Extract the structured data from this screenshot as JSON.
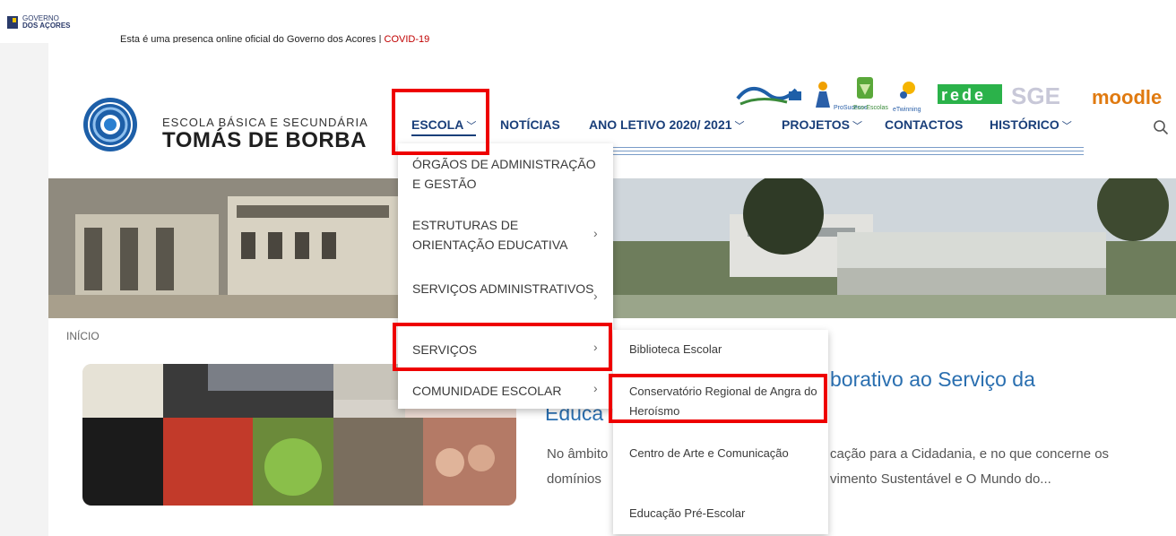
{
  "gov_bar": {
    "name_line1": "GOVERNO",
    "name_line2": "DOS AÇORES",
    "notice": "Esta é uma presenca online oficial do Governo dos Acores | ",
    "covid_link": "COVID-19"
  },
  "school": {
    "name_line1": "ESCOLA BÁSICA E SECUNDÁRIA",
    "name_line2": "TOMÁS DE BORBA"
  },
  "nav": {
    "escola": "ESCOLA",
    "noticias": "NOTÍCIAS",
    "ano_letivo": "ANO LETIVO 2020/ 2021",
    "projetos": "PROJETOS",
    "contactos": "CONTACTOS",
    "historico": "HISTÓRICO"
  },
  "partner_logos": [
    "ProSucesso",
    "Eco-Escolas",
    "eTwinning",
    "rede",
    "SGE",
    "moodle"
  ],
  "dropdown": {
    "items": [
      "ÓRGÃOS DE ADMINISTRAÇÃO E GESTÃO",
      "ESTRUTURAS DE ORIENTAÇÃO EDUCATIVA",
      "SERVIÇOS ADMINISTRATIVOS",
      "SERVIÇOS",
      "COMUNIDADE ESCOLAR"
    ]
  },
  "submenu": {
    "items": [
      "Biblioteca Escolar",
      "Conservatório Regional de Angra do Heroísmo",
      "Centro de Arte e Comunicação",
      "Educação Pré-Escolar"
    ]
  },
  "breadcrumb": "INÍCIO",
  "article": {
    "title_a": "borativo ao Serviço da",
    "title_b": "Educa",
    "excerpt_1a": "No âmbito",
    "excerpt_1b": "cação para a Cidadania, e no que concerne os",
    "excerpt_2a": "domínios",
    "excerpt_2b": "vimento Sustentável e O Mundo do..."
  },
  "colors": {
    "nav": "#1a3f7a",
    "title": "#2a6fb0",
    "highlight": "#ee0000"
  }
}
